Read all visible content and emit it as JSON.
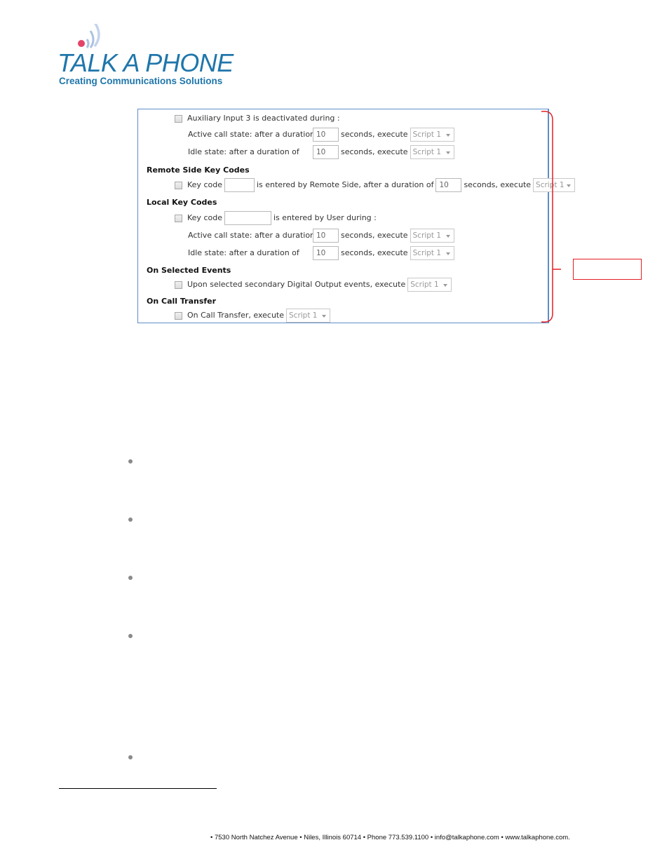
{
  "logo": {
    "brand": "TALK A PHONE",
    "tagline": "Creating Communications Solutions",
    "colors": {
      "text": "#1f76ab",
      "dot": "#e3456a",
      "waves": "#a9c2e3"
    }
  },
  "panel": {
    "aux_input": {
      "label": "Auxiliary Input 3 is deactivated during :",
      "active": {
        "label": "Active call state: after a duration of",
        "value": "10",
        "suffix": "seconds, execute",
        "script": "Script 1"
      },
      "idle": {
        "label": "Idle state: after a duration of",
        "value": "10",
        "suffix": "seconds, execute",
        "script": "Script 1"
      }
    },
    "remote_key_codes": {
      "header": "Remote Side Key Codes",
      "label": "Key code",
      "key_value": "",
      "mid": "is entered by Remote Side, after a duration of",
      "value": "10",
      "suffix": "seconds, execute",
      "script": "Script 1"
    },
    "local_key_codes": {
      "header": "Local Key Codes",
      "label": "Key code",
      "key_value": "",
      "mid": "is entered by User during :",
      "active": {
        "label": "Active call state: after a duration of",
        "value": "10",
        "suffix": "seconds, execute",
        "script": "Script 1"
      },
      "idle": {
        "label": "Idle state: after a duration of",
        "value": "10",
        "suffix": "seconds, execute",
        "script": "Script 1"
      }
    },
    "selected_events": {
      "header": "On Selected Events",
      "label": "Upon selected secondary Digital Output events, execute",
      "script": "Script 1"
    },
    "call_transfer": {
      "header": "On Call Transfer",
      "label": "On Call Transfer, execute",
      "script": "Script 1"
    }
  },
  "callout": {
    "color": "#e31e24",
    "text": ""
  },
  "bullets_count": 5,
  "footer": {
    "text": "• 7530 North Natchez Avenue • Niles, Illinois 60714 • Phone 773.539.1100 • info@talkaphone.com • www.talkaphone.com."
  }
}
